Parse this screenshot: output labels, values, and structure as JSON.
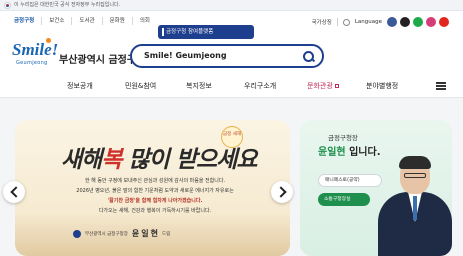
{
  "gov_banner": {
    "text": "이 누리집은 대한민국 공식 전자정부 누리집입니다."
  },
  "utility": {
    "links": [
      "금정구청",
      "보건소",
      "도서관",
      "문화원",
      "의회"
    ],
    "portal_label": "금정구청 참여플랫폼",
    "national_label": "국가상징",
    "language_label": "Language",
    "sns": [
      {
        "icon": "facebook-icon",
        "color": "#3b5998"
      },
      {
        "icon": "x-icon",
        "color": "#222222"
      },
      {
        "icon": "blog-icon",
        "color": "#1faa4a"
      },
      {
        "icon": "instagram-icon",
        "color": "#d63b7a"
      },
      {
        "icon": "youtube-icon",
        "color": "#e0261f"
      }
    ]
  },
  "header": {
    "logo_text": "Smile!",
    "logo_sub": "Geumjeong",
    "district_name": "부산광역시 금정구",
    "search_value": "Smile! Geumjeong"
  },
  "nav": {
    "items": [
      "정보공개",
      "민원&참여",
      "복지정보",
      "우리구소개",
      "문화관광",
      "분야별행정"
    ],
    "active_index": 4
  },
  "banner": {
    "badge": "금정 새해",
    "callig_a": "새해",
    "callig_b": "복",
    "callig_c": "많이 받으세요",
    "greeting_1": "한 해 동안 구정에 보내주신 관심과 성원에 감사의 마음을 전합니다.",
    "greeting_2": "2026년 병오년, 붉은 말의 힘찬 기운처럼 도약과 새로운 에너지가 자유로는",
    "greeting_3": "'활기찬 금정'을 함께 힘차게 나아가겠습니다.",
    "greeting_4": "다가오는 새해, 건강과 행복이 가득하시기를 바랍니다.",
    "sign_org": "부산광역시 금정구청장",
    "sign_name": "윤 일 현",
    "sign_tail": "드림"
  },
  "mayor": {
    "role": "금정구청장",
    "name": "윤일현",
    "name_suffix": " 입니다.",
    "btn_manifesto": "매니페스토(공약)",
    "btn_office": "소통구청장실"
  }
}
